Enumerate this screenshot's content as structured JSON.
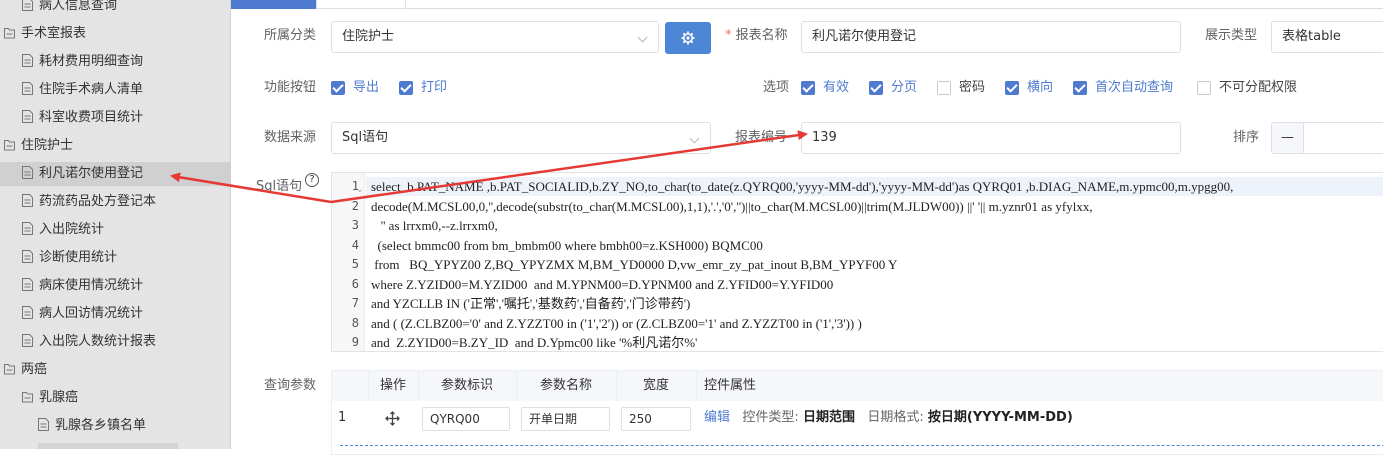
{
  "sidebar": {
    "items": [
      {
        "label": "病人信息查询",
        "level": 1,
        "icon": "document-icon"
      },
      {
        "label": "手术室报表",
        "level": 0,
        "icon": "folder-icon"
      },
      {
        "label": "耗材费用明细查询",
        "level": 1,
        "icon": "document-icon"
      },
      {
        "label": "住院手术病人清单",
        "level": 1,
        "icon": "document-icon"
      },
      {
        "label": "科室收费项目统计",
        "level": 1,
        "icon": "document-icon"
      },
      {
        "label": "住院护士",
        "level": 0,
        "icon": "folder-icon"
      },
      {
        "label": "利凡诺尔使用登记",
        "level": 1,
        "icon": "document-icon",
        "selected": true
      },
      {
        "label": "药流药品处方登记本",
        "level": 1,
        "icon": "document-icon"
      },
      {
        "label": "入出院统计",
        "level": 1,
        "icon": "document-icon"
      },
      {
        "label": "诊断使用统计",
        "level": 1,
        "icon": "document-icon"
      },
      {
        "label": "病床使用情况统计",
        "level": 1,
        "icon": "document-icon"
      },
      {
        "label": "病人回访情况统计",
        "level": 1,
        "icon": "document-icon"
      },
      {
        "label": "入出院人数统计报表",
        "level": 1,
        "icon": "document-icon"
      },
      {
        "label": "两癌",
        "level": 0,
        "icon": "folder-icon"
      },
      {
        "label": "乳腺癌",
        "level": 1,
        "icon": "folder-icon"
      },
      {
        "label": "乳腺各乡镇名单",
        "level": 2,
        "icon": "document-icon"
      }
    ]
  },
  "form": {
    "category_label": "所属分类",
    "category_value": "住院护士",
    "report_name_label": "报表名称",
    "report_name_required": "*",
    "report_name_value": "利凡诺尔使用登记",
    "display_type_label": "展示类型",
    "display_type_value": "表格table",
    "function_buttons_label": "功能按钮",
    "export_label": "导出",
    "print_label": "打印",
    "options_label": "选项",
    "options": [
      {
        "label": "有效",
        "checked": true
      },
      {
        "label": "分页",
        "checked": true
      },
      {
        "label": "密码",
        "checked": false
      },
      {
        "label": "横向",
        "checked": true
      },
      {
        "label": "首次自动查询",
        "checked": true
      },
      {
        "label": "不可分配权限",
        "checked": false
      }
    ],
    "data_source_label": "数据来源",
    "data_source_value": "Sql语句",
    "report_code_label": "报表编号",
    "report_code_value": "139",
    "sort_label": "排序",
    "sort_minus": "—",
    "sql_label": "Sql语句",
    "help_icon_text": "?"
  },
  "sql": {
    "lines": [
      {
        "n": "1",
        "text": "select  b.PAT_NAME ,b.PAT_SOCIALID,b.ZY_NO,to_char(to_date(z.QYRQ00,'yyyy-MM-dd'),'yyyy-MM-dd')as QYRQ01 ,b.DIAG_NAME,m.ypmc00,m.ypgg00,"
      },
      {
        "n": "2",
        "text": "decode(M.MCSL00,0,'',decode(substr(to_char(M.MCSL00),1,1),'.','0','')||to_char(M.MCSL00)||trim(M.JLDW00)) ||' '|| m.yznr01 as yfylxx,"
      },
      {
        "n": "3",
        "text": "   '' as lrrxm0,--z.lrrxm0,"
      },
      {
        "n": "4",
        "text": "  (select bmmc00 from bm_bmbm00 where bmbh00=z.KSH000) BQMC00"
      },
      {
        "n": "5",
        "text": " from   BQ_YPYZ00 Z,BQ_YPYZMX M,BM_YD0000 D,vw_emr_zy_pat_inout B,BM_YPYF00 Y"
      },
      {
        "n": "6",
        "text": "where Z.YZID00=M.YZID00  and M.YPNM00=D.YPNM00 and Z.YFID00=Y.YFID00"
      },
      {
        "n": "7",
        "text": "and YZCLLB IN ('正常','嘱托','基数药','自备药','门诊带药')"
      },
      {
        "n": "8",
        "text": "and ( (Z.CLBZ00='0' and Z.YZZT00 in ('1','2')) or (Z.CLBZ00='1' and Z.YZZT00 in ('1','3')) )"
      },
      {
        "n": "9",
        "text": "and  Z.ZYID00=B.ZY_ID  and D.Ypmc00 like '%利凡诺尔%'"
      }
    ]
  },
  "params": {
    "label": "查询参数",
    "headers": [
      "操作",
      "参数标识",
      "参数名称",
      "宽度",
      "控件属性"
    ],
    "rows": [
      {
        "index": "1",
        "id": "QYRQ00",
        "name": "开单日期",
        "width": "250",
        "edit": "编辑",
        "control_type_label": "控件类型:",
        "control_type_value": "日期范围",
        "date_format_label": "日期格式:",
        "date_format_value": "按日期(YYYY-MM-DD)"
      }
    ]
  },
  "colors": {
    "accent": "#4e7bcf",
    "annotation_arrow": "#e53935"
  }
}
